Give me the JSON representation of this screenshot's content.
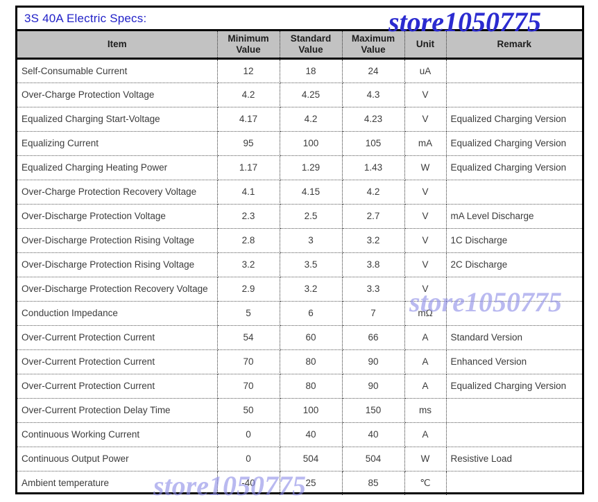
{
  "title": "3S 40A Electric Specs:",
  "watermarks": {
    "top": "store1050775",
    "middle": "store1050775",
    "bottom": "store1050775"
  },
  "colors": {
    "title": "#2222C8",
    "remark": "#1A1AC0",
    "header_bg": "#C2C2C2",
    "watermark": "#8F8FE8"
  },
  "table": {
    "headers": [
      "Item",
      "Minimum\nValue",
      "Standard\nValue",
      "Maximum\nValue",
      "Unit",
      "Remark"
    ],
    "header_item": "Item",
    "header_min_l1": "Minimum",
    "header_min_l2": "Value",
    "header_std_l1": "Standard",
    "header_std_l2": "Value",
    "header_max_l1": "Maximum",
    "header_max_l2": "Value",
    "header_unit": "Unit",
    "header_remark": "Remark",
    "rows": [
      {
        "item": "Self-Consumable Current",
        "min": "12",
        "std": "18",
        "max": "24",
        "unit": "uA",
        "remark": ""
      },
      {
        "item": "Over-Charge Protection Voltage",
        "min": "4.2",
        "std": "4.25",
        "max": "4.3",
        "unit": "V",
        "remark": ""
      },
      {
        "item": "Equalized Charging Start-Voltage",
        "min": "4.17",
        "std": "4.2",
        "max": "4.23",
        "unit": "V",
        "remark": "Equalized Charging Version"
      },
      {
        "item": "Equalizing Current",
        "min": "95",
        "std": "100",
        "max": "105",
        "unit": "mA",
        "remark": "Equalized Charging Version"
      },
      {
        "item": "Equalized Charging Heating Power",
        "min": "1.17",
        "std": "1.29",
        "max": "1.43",
        "unit": "W",
        "remark": "Equalized Charging Version"
      },
      {
        "item": "Over-Charge Protection Recovery Voltage",
        "min": "4.1",
        "std": "4.15",
        "max": "4.2",
        "unit": "V",
        "remark": ""
      },
      {
        "item": "Over-Discharge Protection Voltage",
        "min": "2.3",
        "std": "2.5",
        "max": "2.7",
        "unit": "V",
        "remark": "mA Level Discharge"
      },
      {
        "item": "Over-Discharge Protection  Rising Voltage",
        "min": "2.8",
        "std": "3",
        "max": "3.2",
        "unit": "V",
        "remark": "1C Discharge"
      },
      {
        "item": "Over-Discharge Protection  Rising Voltage",
        "min": "3.2",
        "std": "3.5",
        "max": "3.8",
        "unit": "V",
        "remark": "2C Discharge"
      },
      {
        "item": "Over-Discharge Protection Recovery Voltage",
        "min": "2.9",
        "std": "3.2",
        "max": "3.3",
        "unit": "V",
        "remark": ""
      },
      {
        "item": "Conduction Impedance",
        "min": "5",
        "std": "6",
        "max": "7",
        "unit": "mΩ",
        "remark": ""
      },
      {
        "item": "Over-Current Protection Current",
        "min": "54",
        "std": "60",
        "max": "66",
        "unit": "A",
        "remark": "Standard Version"
      },
      {
        "item": "Over-Current Protection Current",
        "min": "70",
        "std": "80",
        "max": "90",
        "unit": "A",
        "remark": "Enhanced Version"
      },
      {
        "item": "Over-Current Protection Current",
        "min": "70",
        "std": "80",
        "max": "90",
        "unit": "A",
        "remark": "Equalized Charging Version"
      },
      {
        "item": "Over-Current Protection Delay Time",
        "min": "50",
        "std": "100",
        "max": "150",
        "unit": "ms",
        "remark": ""
      },
      {
        "item": "Continuous Working Current",
        "min": "0",
        "std": "40",
        "max": "40",
        "unit": "A",
        "remark": ""
      },
      {
        "item": "Continuous Output Power",
        "min": "0",
        "std": "504",
        "max": "504",
        "unit": "W",
        "remark": "Resistive Load"
      },
      {
        "item": "Ambient temperature",
        "min": "-40",
        "std": "25",
        "max": "85",
        "unit": "℃",
        "remark": ""
      }
    ]
  }
}
